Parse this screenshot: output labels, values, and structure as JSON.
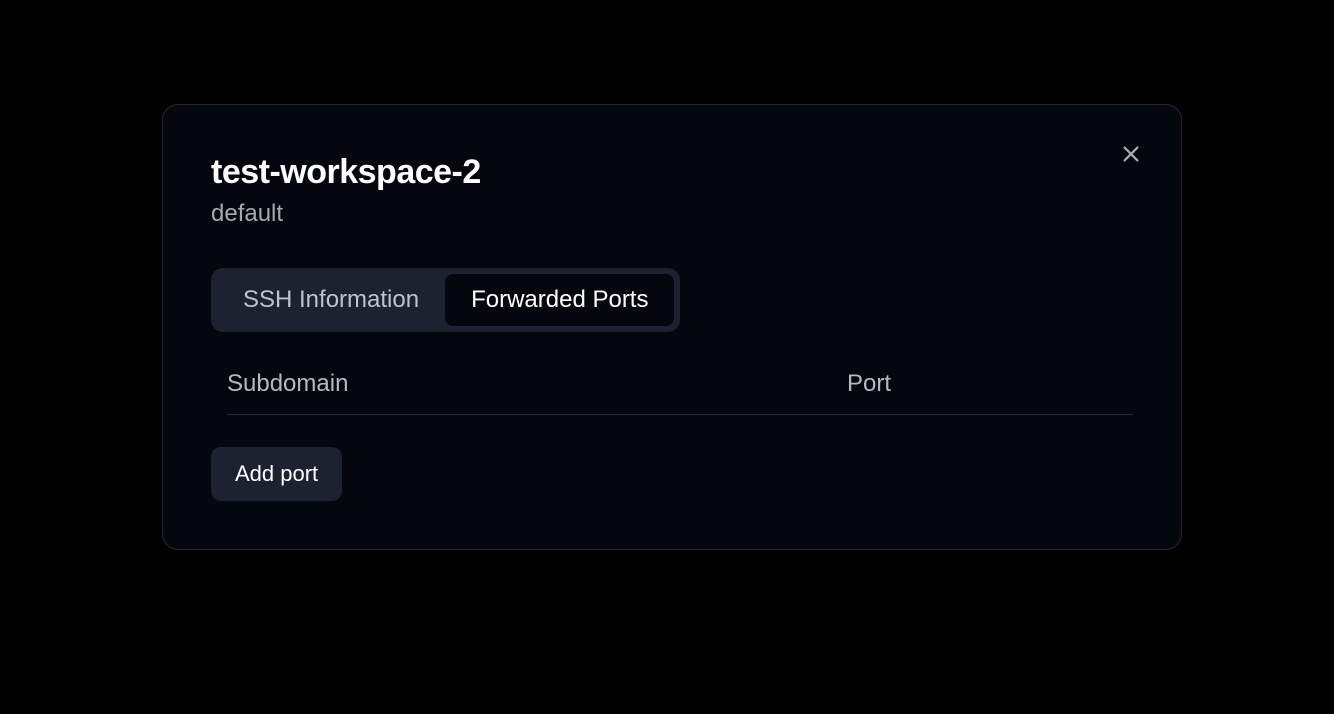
{
  "dialog": {
    "title": "test-workspace-2",
    "subtitle": "default",
    "tabs": {
      "ssh": "SSH Information",
      "forwarded_ports": "Forwarded Ports"
    },
    "table": {
      "col_subdomain": "Subdomain",
      "col_port": "Port"
    },
    "buttons": {
      "add_port": "Add port"
    }
  }
}
